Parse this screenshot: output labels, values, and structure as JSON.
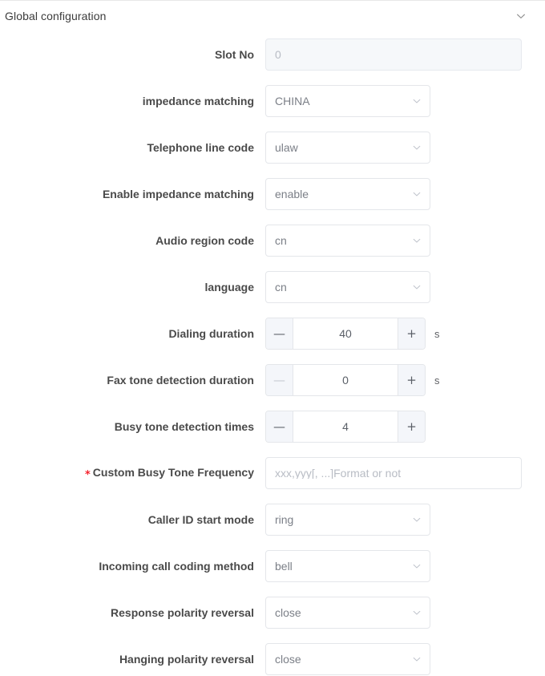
{
  "panel": {
    "title": "Global configuration",
    "collapse_icon": "chevron-down-icon"
  },
  "form": {
    "rows": [
      {
        "label": "Slot No",
        "required": false,
        "type": "input",
        "value": "0",
        "placeholder": "0",
        "disabled": true,
        "unit": ""
      },
      {
        "label": "impedance matching",
        "required": false,
        "type": "select",
        "value": "CHINA",
        "unit": ""
      },
      {
        "label": "Telephone line code",
        "required": false,
        "type": "select",
        "value": "ulaw",
        "unit": ""
      },
      {
        "label": "Enable impedance matching",
        "required": false,
        "type": "select",
        "value": "enable",
        "unit": ""
      },
      {
        "label": "Audio region code",
        "required": false,
        "type": "select",
        "value": "cn",
        "unit": ""
      },
      {
        "label": "language",
        "required": false,
        "type": "select",
        "value": "cn",
        "unit": ""
      },
      {
        "label": "Dialing duration",
        "required": false,
        "type": "stepper",
        "value": "40",
        "minus_label": "—",
        "plus_label": "+",
        "minus_dim": false,
        "unit": "s"
      },
      {
        "label": "Fax tone detection duration",
        "required": false,
        "type": "stepper",
        "value": "0",
        "minus_label": "—",
        "plus_label": "+",
        "minus_dim": true,
        "unit": "s"
      },
      {
        "label": "Busy tone detection times",
        "required": false,
        "type": "stepper",
        "value": "4",
        "minus_label": "—",
        "plus_label": "+",
        "minus_dim": false,
        "unit": ""
      },
      {
        "label": "Custom Busy Tone Frequency",
        "required": true,
        "required_marker": "*",
        "type": "input",
        "value": "",
        "placeholder": "xxx,yyy[, ...]Format or not",
        "disabled": false,
        "unit": ""
      },
      {
        "label": "Caller ID start mode",
        "required": false,
        "type": "select",
        "value": "ring",
        "unit": ""
      },
      {
        "label": "Incoming call coding method",
        "required": false,
        "type": "select",
        "value": "bell",
        "unit": ""
      },
      {
        "label": "Response polarity reversal",
        "required": false,
        "type": "select",
        "value": "close",
        "unit": ""
      },
      {
        "label": "Hanging polarity reversal",
        "required": false,
        "type": "select",
        "value": "close",
        "unit": ""
      }
    ]
  },
  "colors": {
    "required_star": "#f5222d",
    "label": "#4a4a4a",
    "border": "#e4e6ea",
    "placeholder": "#b8bcc4",
    "disabled_bg": "#f6f8fa",
    "stepper_btn_bg": "#f4f6fa"
  }
}
